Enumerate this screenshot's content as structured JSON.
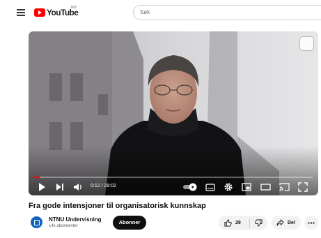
{
  "header": {
    "logo_text": "YouTube",
    "region": "NO",
    "search_placeholder": "Søk"
  },
  "player": {
    "current_time": "0:12",
    "duration": "29:02",
    "time_display": "0:12 / 29:02",
    "progress_fraction": 0.007,
    "accent_color": "#ff0000"
  },
  "video": {
    "title": "Fra gode intensjoner til organisatorisk kunnskap"
  },
  "channel": {
    "name": "NTNU Undervisning",
    "subscribers": "14k abonnenter",
    "subscribe_label": "Abonner"
  },
  "actions": {
    "like_count": "29",
    "share_label": "Del"
  }
}
